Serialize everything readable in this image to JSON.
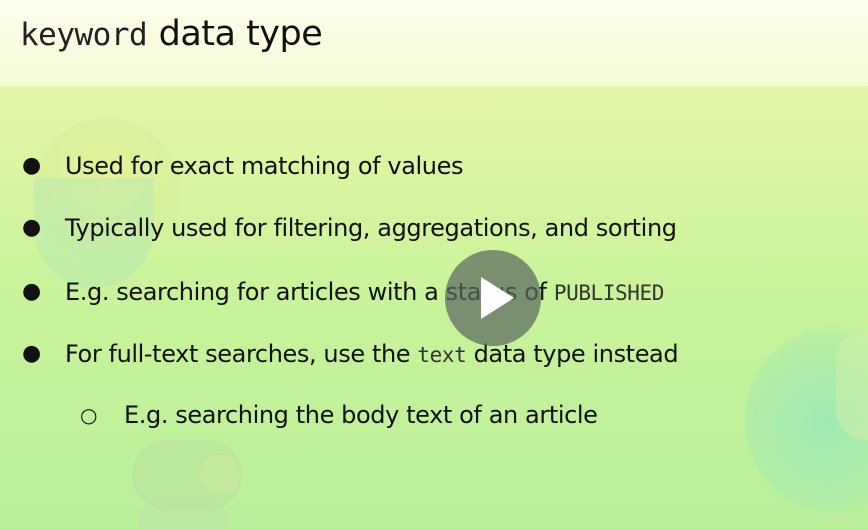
{
  "slide": {
    "title": {
      "code": "keyword",
      "text": "data type"
    },
    "bullets": [
      {
        "marker": "●",
        "text": "Used for exact matching of values"
      },
      {
        "marker": "●",
        "text": "Typically used for filtering, aggregations, and sorting"
      },
      {
        "marker": "●",
        "text_before": "E.g. searching for articles with a status of ",
        "code": "PUBLISHED"
      },
      {
        "marker": "●",
        "text_before": "For full-text searches, use the ",
        "code": "text",
        "text_after": " data type instead"
      }
    ],
    "sub_bullet": {
      "marker": "○",
      "text": "E.g. searching the body text of an article"
    }
  },
  "player": {
    "play_icon": "play-icon"
  },
  "colors": {
    "background_top": "#f3f8cf",
    "background_bottom": "#b9f09c",
    "play_button": "#5a695f"
  }
}
